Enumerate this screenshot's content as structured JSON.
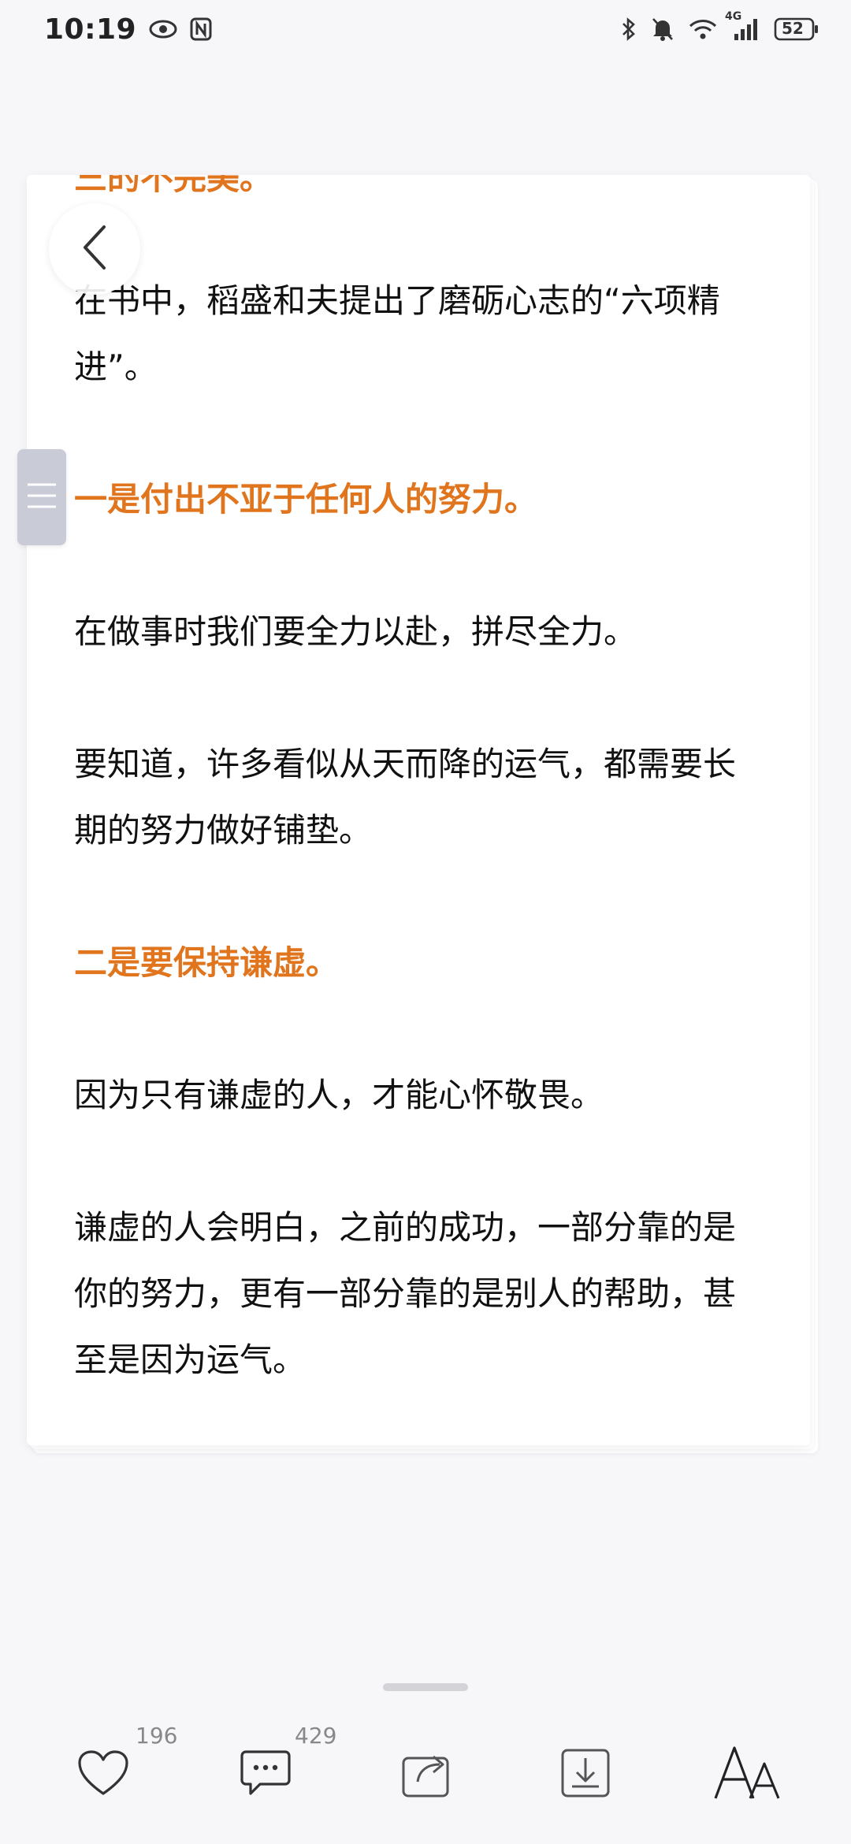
{
  "status_bar": {
    "time": "10:19",
    "battery": "52",
    "network": "4G"
  },
  "article": {
    "clipped_heading": "三的不完美。",
    "paragraphs": [
      {
        "text": "在书中，稻盛和夫提出了磨砺心志的“六项精进”。",
        "style": "body"
      },
      {
        "text": "一是付出不亚于任何人的努力。",
        "style": "heading"
      },
      {
        "text": "在做事时我们要全力以赴，拼尽全力。",
        "style": "body"
      },
      {
        "text": "要知道，许多看似从天而降的运气，都需要长期的努力做好铺垫。",
        "style": "body"
      },
      {
        "text": "二是要保持谦虚。",
        "style": "heading"
      },
      {
        "text": "因为只有谦虚的人，才能心怀敬畏。",
        "style": "body"
      },
      {
        "text": "谦虚的人会明白，之前的成功，一部分靠的是你的努力，更有一部分靠的是别人的帮助，甚至是因为运气。",
        "style": "body"
      }
    ]
  },
  "toolbar": {
    "like_count": "196",
    "comment_count": "429",
    "font_label": "AA"
  },
  "colors": {
    "accent": "#e0751e",
    "background": "#f7f6f9"
  },
  "icons": [
    "eye-icon",
    "nfc-icon",
    "bluetooth-icon",
    "mute-icon",
    "wifi-icon",
    "signal-icon",
    "battery-icon",
    "back-icon",
    "menu-icon",
    "heart-icon",
    "comment-icon",
    "share-icon",
    "download-icon",
    "font-size-icon"
  ]
}
